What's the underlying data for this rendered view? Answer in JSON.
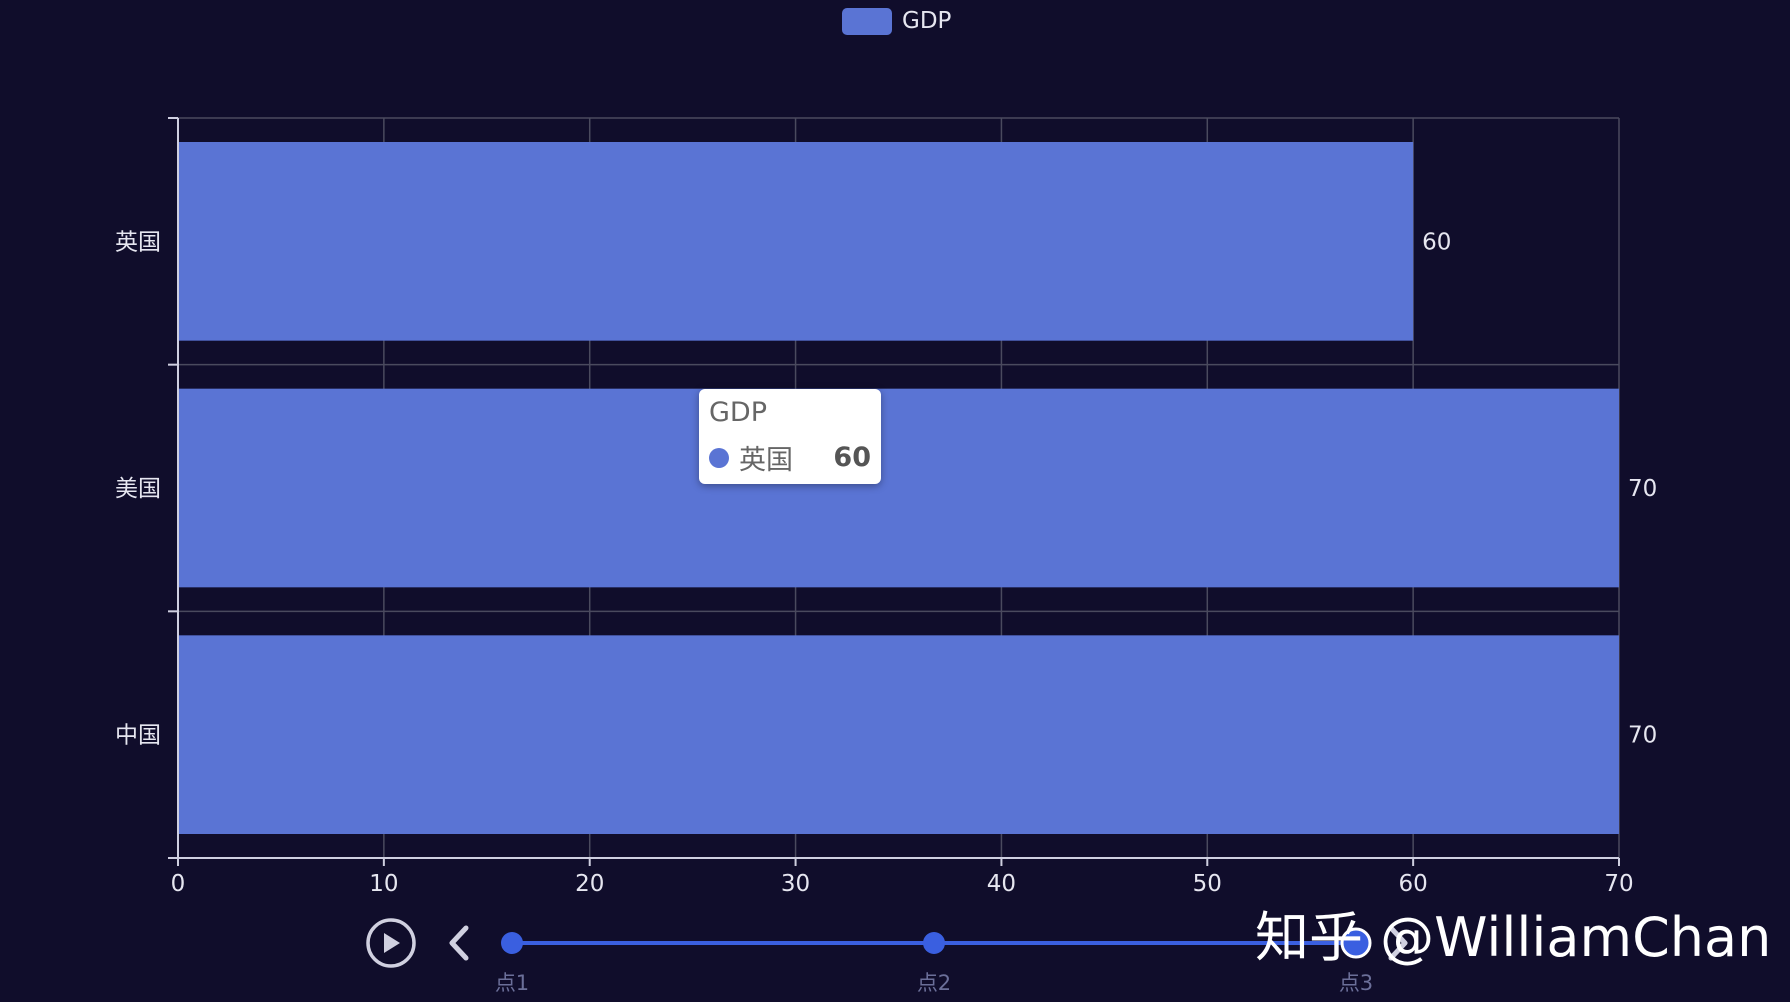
{
  "chart_data": {
    "type": "bar",
    "orientation": "horizontal",
    "categories": [
      "中国",
      "美国",
      "英国"
    ],
    "series": [
      {
        "name": "GDP",
        "values": [
          70,
          70,
          60
        ]
      }
    ],
    "xlim": [
      0,
      70
    ],
    "x_ticks": [
      0,
      10,
      20,
      30,
      40,
      50,
      60,
      70
    ],
    "grid": true,
    "legend": "top-center",
    "data_labels": true
  },
  "colors": {
    "background": "#100d2b",
    "bar": "#5a74d4",
    "grid": "#4a4a5e",
    "timeline": "#3a5fe0"
  },
  "tooltip": {
    "title": "GDP",
    "item_name": "英国",
    "item_value": "60"
  },
  "timeline": {
    "points": [
      "点1",
      "点2",
      "点3"
    ],
    "current_index": 2,
    "play_icon": "play-icon",
    "prev_icon": "chevron-left-icon",
    "next_icon": "chevron-right-icon"
  },
  "watermark": "知乎 @WilliamChan"
}
